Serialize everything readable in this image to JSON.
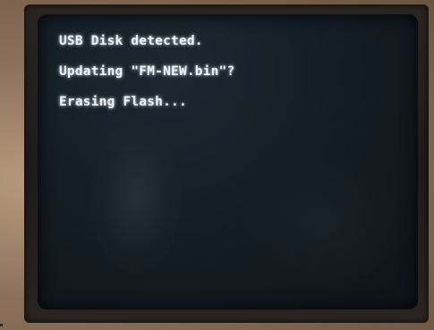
{
  "screen": {
    "lines": [
      "USB Disk detected.",
      "Updating \"FM-NEW.bin\"?",
      "Erasing Flash..."
    ]
  },
  "colors": {
    "screen_text": "#eef2f4",
    "screen_background": "#141d24",
    "bezel": "#221e1c",
    "led": "#d24b44",
    "backdrop": "#8d715a"
  }
}
